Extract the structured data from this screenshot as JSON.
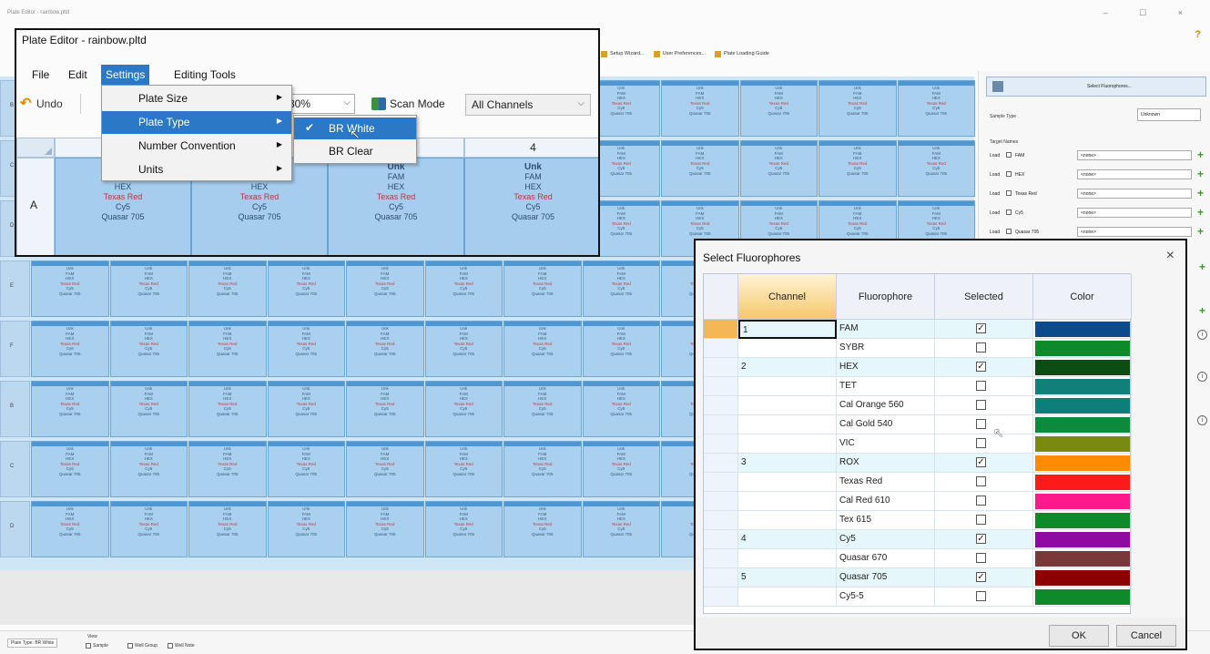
{
  "background_window": {
    "title": "Plate Editor - rainbow.pltd",
    "window_controls": "–  ☐  ×",
    "help_icon": "?",
    "toolbar": [
      "Setup Wizard...",
      "User Preferences...",
      "Plate Loading Guide"
    ],
    "well_lines": [
      "Unk",
      "FAM",
      "HEX",
      "Texas Red",
      "Cy5",
      "Quasar 705"
    ],
    "row_labels": [
      "B",
      "C",
      "D",
      "E",
      "F"
    ],
    "col_labels": [
      "7",
      "8",
      "9",
      "10",
      "11",
      "12"
    ]
  },
  "right_panel": {
    "select_fluorophores_button": "Select Fluorophores...",
    "sample_type_label": "Sample Type",
    "sample_type_value": "Unknown",
    "target_names_label": "Target Names",
    "targets": [
      {
        "load": "Load",
        "name": "FAM",
        "value": "<none>"
      },
      {
        "load": "Load",
        "name": "HEX",
        "value": "<none>"
      },
      {
        "load": "Load",
        "name": "Texas Red",
        "value": "<none>"
      },
      {
        "load": "Load",
        "name": "Cy5",
        "value": "<none>"
      },
      {
        "load": "Load",
        "name": "Quasar 705",
        "value": "<none>"
      }
    ],
    "plus_icon": "+",
    "info_icon": "i"
  },
  "status_bar": {
    "plate_type": "Plate Type: BR White",
    "view_label": "View",
    "checks": [
      "Sample",
      "Well Group",
      "Well Note"
    ]
  },
  "plate_editor": {
    "title": "Plate Editor - rainbow.pltd",
    "menu": [
      "File",
      "Edit",
      "Settings",
      "Editing Tools"
    ],
    "undo_label": "Undo",
    "zoom_value": "30%",
    "scan_mode_label": "Scan Mode",
    "scan_mode_value": "All Channels",
    "col_headers": [
      "1",
      "2",
      "3",
      "4"
    ],
    "row_a": "A",
    "wells": [
      {
        "lines": [
          "Unk",
          "FAM",
          "HEX",
          "Texas Red",
          "Cy5",
          "Quasar 705"
        ]
      },
      {
        "lines": [
          "Unk",
          "FAM",
          "HEX",
          "Texas Red",
          "Cy5",
          "Quasar 705"
        ]
      },
      {
        "lines": [
          "Unk",
          "FAM",
          "HEX",
          "Texas Red",
          "Cy5",
          "Quasar 705"
        ]
      },
      {
        "lines": [
          "Unk",
          "FAM",
          "HEX",
          "Texas Red",
          "Cy5",
          "Quasar 705"
        ]
      }
    ],
    "settings_menu": [
      "Plate Size",
      "Plate Type",
      "Number Convention",
      "Units"
    ],
    "plate_type_menu": [
      "BR White",
      "BR Clear"
    ],
    "arrow": "▶",
    "check": "✔",
    "dropdown_arrow": "⌵",
    "cursor": "↖"
  },
  "fluor_dialog": {
    "title": "Select Fluorophores",
    "close": "×",
    "headers": [
      "Channel",
      "Fluorophore",
      "Selected",
      "Color"
    ],
    "check_mark": "✓",
    "cursor": "↖",
    "rows": [
      {
        "channel": "1",
        "fluorophore": "FAM",
        "selected": true,
        "color": "#0b4a8b"
      },
      {
        "channel": "",
        "fluorophore": "SYBR",
        "selected": false,
        "color": "#0d8a2a"
      },
      {
        "channel": "2",
        "fluorophore": "HEX",
        "selected": true,
        "color": "#0b4d12"
      },
      {
        "channel": "",
        "fluorophore": "TET",
        "selected": false,
        "color": "#12807a"
      },
      {
        "channel": "",
        "fluorophore": "Cal Orange 560",
        "selected": false,
        "color": "#0d7f7a"
      },
      {
        "channel": "",
        "fluorophore": "Cal Gold 540",
        "selected": false,
        "color": "#0e8a3c"
      },
      {
        "channel": "",
        "fluorophore": "VIC",
        "selected": false,
        "color": "#7a8a10"
      },
      {
        "channel": "3",
        "fluorophore": "ROX",
        "selected": true,
        "color": "#ff8c00"
      },
      {
        "channel": "",
        "fluorophore": "Texas Red",
        "selected": false,
        "color": "#ff1a1a"
      },
      {
        "channel": "",
        "fluorophore": "Cal Red 610",
        "selected": false,
        "color": "#ff1a8c"
      },
      {
        "channel": "",
        "fluorophore": "Tex 615",
        "selected": false,
        "color": "#0e8a2a"
      },
      {
        "channel": "4",
        "fluorophore": "Cy5",
        "selected": true,
        "color": "#8e0aa0"
      },
      {
        "channel": "",
        "fluorophore": "Quasar 670",
        "selected": false,
        "color": "#7a3838"
      },
      {
        "channel": "5",
        "fluorophore": "Quasar 705",
        "selected": true,
        "color": "#8b0000"
      },
      {
        "channel": "",
        "fluorophore": "Cy5-5",
        "selected": false,
        "color": "#0e8a2a"
      }
    ],
    "ok": "OK",
    "cancel": "Cancel"
  }
}
